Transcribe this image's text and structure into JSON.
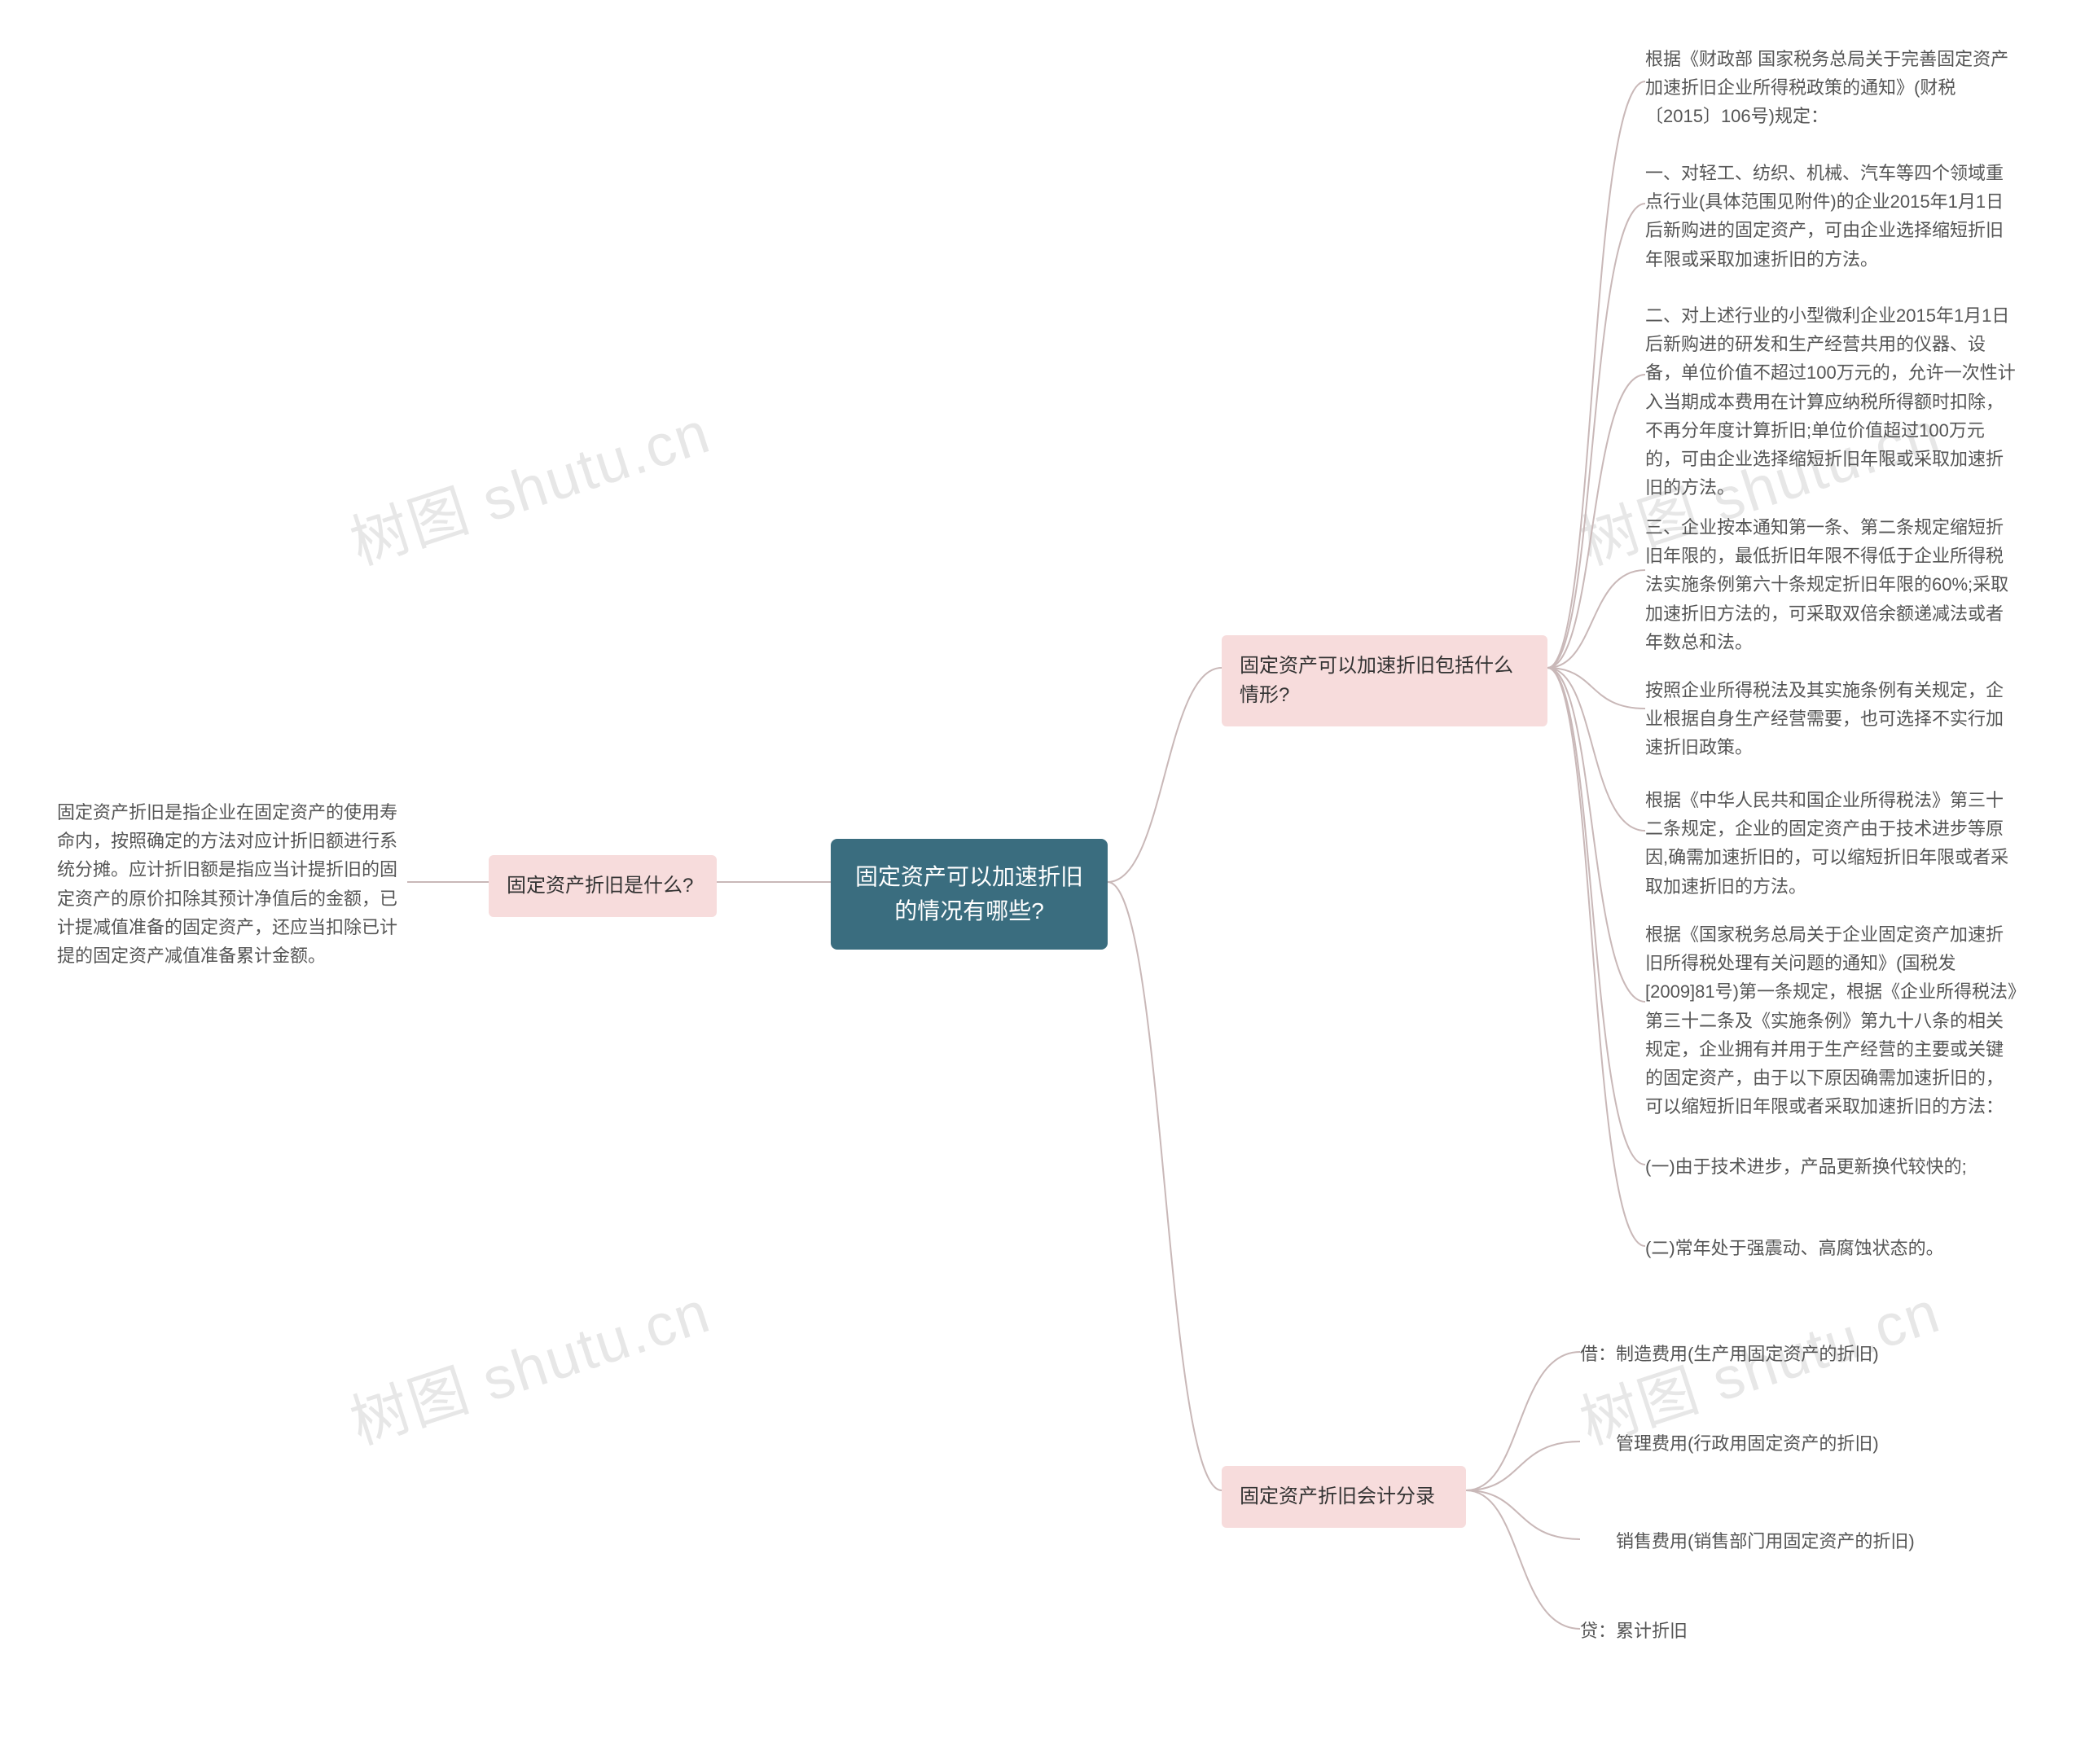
{
  "root": {
    "title": "固定资产可以加速折旧的情况有哪些?"
  },
  "left": {
    "branch1": {
      "label": "固定资产折旧是什么?",
      "leaf1": "固定资产折旧是指企业在固定资产的使用寿命内，按照确定的方法对应计折旧额进行系统分摊。应计折旧额是指应当计提折旧的固定资产的原价扣除其预计净值后的金额，已计提减值准备的固定资产，还应当扣除已计提的固定资产减值准备累计金额。"
    }
  },
  "right": {
    "branch1": {
      "label": "固定资产可以加速折旧包括什么情形?",
      "leaves": [
        "根据《财政部 国家税务总局关于完善固定资产加速折旧企业所得税政策的通知》(财税〔2015〕106号)规定：",
        "一、对轻工、纺织、机械、汽车等四个领域重点行业(具体范围见附件)的企业2015年1月1日后新购进的固定资产，可由企业选择缩短折旧年限或采取加速折旧的方法。",
        "二、对上述行业的小型微利企业2015年1月1日后新购进的研发和生产经营共用的仪器、设备，单位价值不超过100万元的，允许一次性计入当期成本费用在计算应纳税所得额时扣除，不再分年度计算折旧;单位价值超过100万元的，可由企业选择缩短折旧年限或采取加速折旧的方法。",
        "三、企业按本通知第一条、第二条规定缩短折旧年限的，最低折旧年限不得低于企业所得税法实施条例第六十条规定折旧年限的60%;采取加速折旧方法的，可采取双倍余额递减法或者年数总和法。",
        "按照企业所得税法及其实施条例有关规定，企业根据自身生产经营需要，也可选择不实行加速折旧政策。",
        "根据《中华人民共和国企业所得税法》第三十二条规定，企业的固定资产由于技术进步等原因,确需加速折旧的，可以缩短折旧年限或者采取加速折旧的方法。",
        "根据《国家税务总局关于企业固定资产加速折旧所得税处理有关问题的通知》(国税发[2009]81号)第一条规定，根据《企业所得税法》第三十二条及《实施条例》第九十八条的相关规定，企业拥有并用于生产经营的主要或关键的固定资产，由于以下原因确需加速折旧的，可以缩短折旧年限或者采取加速折旧的方法：",
        "(一)由于技术进步，产品更新换代较快的;",
        "(二)常年处于强震动、高腐蚀状态的。"
      ]
    },
    "branch2": {
      "label": "固定资产折旧会计分录",
      "leaves": [
        "借：制造费用(生产用固定资产的折旧)",
        "　　管理费用(行政用固定资产的折旧)",
        "　　销售费用(销售部门用固定资产的折旧)",
        "贷：累计折旧"
      ]
    }
  },
  "watermarks": [
    "树图 shutu.cn",
    "树图 shutu.cn",
    "树图 shutu.cn",
    "树图 shutu.cn"
  ]
}
